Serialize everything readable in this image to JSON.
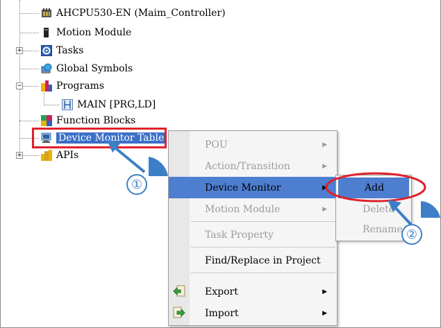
{
  "tree": {
    "items": [
      {
        "label": "AHCPU530-EN  (Maim_Controller)",
        "icon": "cpu-icon"
      },
      {
        "label": "Motion Module",
        "icon": "motion-module-icon"
      },
      {
        "label": "Tasks",
        "icon": "tasks-icon",
        "expander": "+"
      },
      {
        "label": "Global Symbols",
        "icon": "global-symbols-icon"
      },
      {
        "label": "Programs",
        "icon": "programs-icon",
        "expander": "−"
      },
      {
        "label": "MAIN [PRG,LD]",
        "icon": "ladder-program-icon"
      },
      {
        "label": "Function Blocks",
        "icon": "function-blocks-icon"
      },
      {
        "label": "Device Monitor Table",
        "icon": "device-monitor-icon",
        "selected": true
      },
      {
        "label": "APIs",
        "icon": "apis-icon",
        "expander": "+"
      }
    ]
  },
  "context_menu": {
    "items": [
      {
        "label": "POU",
        "disabled": true,
        "submenu": true
      },
      {
        "label": "Action/Transition",
        "disabled": true,
        "submenu": true
      },
      {
        "label": "Device Monitor",
        "disabled": false,
        "submenu": true,
        "highlighted": true
      },
      {
        "label": "Motion Module",
        "disabled": true,
        "submenu": true
      },
      {
        "label": "Task Property",
        "disabled": true
      },
      {
        "label": "Find/Replace in Project",
        "disabled": false
      },
      {
        "label": "Export",
        "disabled": false,
        "submenu": true,
        "icon": "export-icon"
      },
      {
        "label": "Import",
        "disabled": false,
        "submenu": true,
        "icon": "import-icon"
      }
    ]
  },
  "submenu": {
    "items": [
      {
        "label": "Add",
        "highlighted": true
      },
      {
        "label": "Delete",
        "disabled": true
      },
      {
        "label": "Rename",
        "disabled": true
      }
    ]
  },
  "callouts": {
    "one": "①",
    "two": "②"
  },
  "colors": {
    "selection": "#3b6fc9",
    "highlight": "#4d7ed0",
    "annotation_red": "#e0202a",
    "callout_blue": "#3d7fc6"
  }
}
